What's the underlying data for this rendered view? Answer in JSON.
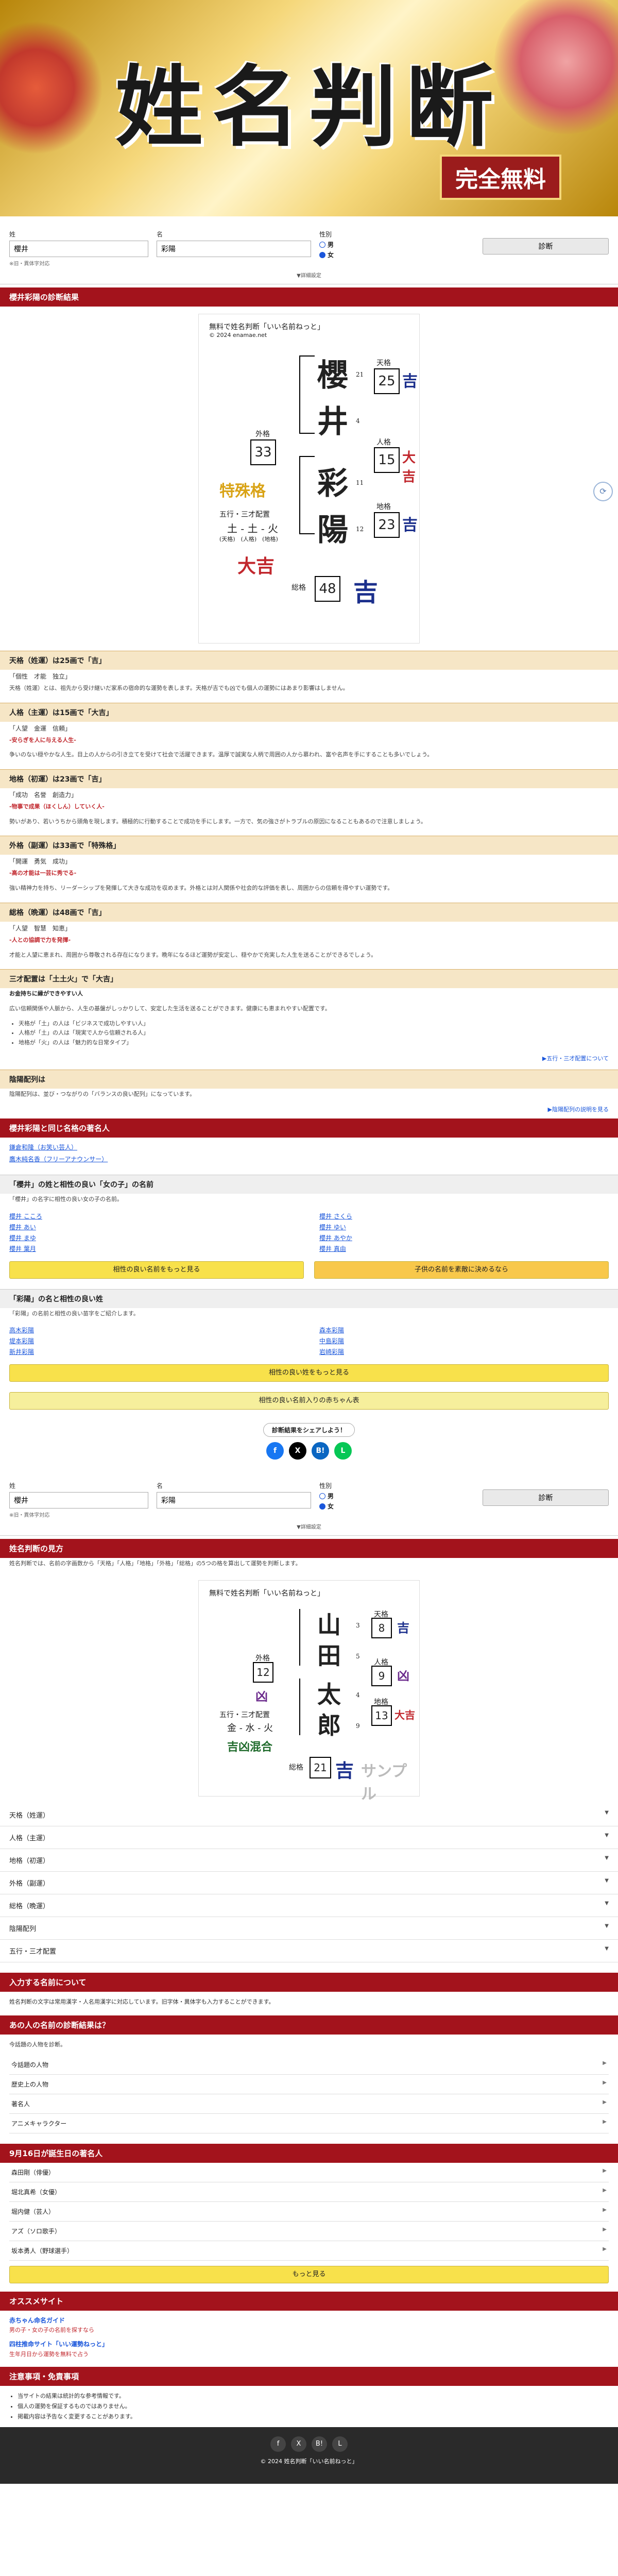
{
  "hero": {
    "title": "姓名判断",
    "badge": "完全無料"
  },
  "form": {
    "sei_label": "姓",
    "mei_label": "名",
    "sei_value": "櫻井",
    "mei_value": "彩陽",
    "gender_label": "性別",
    "male": "男",
    "female": "女",
    "note": "※旧・異体字対応",
    "button": "診断",
    "detail": "▼詳細設定"
  },
  "result": {
    "heading": "櫻井彩陽の診断結果",
    "chart_hdr": "無料で姓名判断「いい名前ねっと」",
    "chart_sub": "© 2024 enamae.net",
    "chars": [
      "櫻",
      "井",
      "彩",
      "陽"
    ],
    "strokes": [
      "21",
      "4",
      "11",
      "12"
    ],
    "grids": [
      {
        "label": "天格",
        "v": "25",
        "r": "吉"
      },
      {
        "label": "人格",
        "v": "15",
        "r": "大吉"
      },
      {
        "label": "地格",
        "v": "23",
        "r": "吉"
      },
      {
        "label": "外格",
        "v": "33",
        "r": ""
      },
      {
        "label": "総格",
        "v": "48",
        "r": "吉"
      }
    ],
    "special": "特殊格",
    "gogyo": "五行・三才配置",
    "gogyo_v": "土 - 土 - 火",
    "gogyo_l": "(天格)　(人格)　(地格)",
    "gogyo_r": "大吉"
  },
  "scores": [
    {
      "h": "天格（姓運）は25画で「吉」",
      "tags": "「個性　才能　独立」",
      "body": "天格（姓運）とは、祖先から受け継いだ家系の宿命的な運勢を表します。天格が吉でも凶でも個人の運勢にはあまり影響はしません。"
    },
    {
      "h": "人格（主運）は15画で「大吉」",
      "tags": "「人望　金運　信頼」",
      "lead": "-安らぎを人に与える人生-",
      "body": "争いのない穏やかな人生。目上の人からの引き立てを受けて社会で活躍できます。温厚で誠実な人柄で周囲の人から慕われ、富や名声を手にすることも多いでしょう。"
    },
    {
      "h": "地格（初運）は23画で「吉」",
      "tags": "「成功　名誉　創造力」",
      "lead": "-物事で成果（ほくしん）していく人-",
      "body": "勢いがあり、若いうちから頭角を現します。積極的に行動することで成功を手にします。一方で、気の強さがトラブルの原因になることもあるので注意しましょう。"
    },
    {
      "h": "外格（副運）は33画で「特殊格」",
      "tags": "「開運　勇気　成功」",
      "lead": "-高の才能は一芸に秀でる-",
      "body": "強い精神力を持ち、リーダーシップを発揮して大きな成功を収めます。外格とは対人関係や社会的な評価を表し、周囲からの信頼を得やすい運勢です。"
    },
    {
      "h": "総格（晩運）は48画で「吉」",
      "tags": "「人望　智慧　知恵」",
      "lead": "-人との協調で力を発揮-",
      "body": "才能と人望に恵まれ、周囲から尊敬される存在になります。晩年になるほど運勢が安定し、穏やかで充実した人生を送ることができるでしょう。"
    }
  ],
  "sansai": {
    "h": "三才配置は「土土火」で「大吉」",
    "lead": "お金持ちに縁ができやすい人",
    "body": "広い信頼関係や人脈から、人生の基盤がしっかりして、安定した生活を送ることができます。健康にも恵まれやすい配置です。",
    "items": [
      "天格が「土」の人は「ビジネスで成功しやすい人」",
      "人格が「土」の人は「現実で人から信頼される人」",
      "地格が「火」の人は「魅力的な日常タイプ」"
    ],
    "link": "▶五行・三才配置について"
  },
  "inyo": {
    "h": "陰陽配列は",
    "body": "陰陽配列は、並び・つながりの「バランスの良い配列」になっています。",
    "link": "▶陰陽配列の説明を見る"
  },
  "famous": {
    "h": "櫻井彩陽と同じ名格の著名人",
    "list": [
      "鎌倉和隆（お笑い芸人）",
      "鷹木純名香（フリーアナウンサー）"
    ]
  },
  "aisho": {
    "h": "「櫻井」の姓と相性の良い「女の子」の名前",
    "intro": "「櫻井」の名字に相性の良い女の子の名前。",
    "names": [
      "櫻井 こころ",
      "櫻井 さくら",
      "櫻井 あい",
      "櫻井 ゆい",
      "櫻井 まゆ",
      "櫻井 あやか",
      "櫻井 葉月",
      "櫻井 真由"
    ],
    "btn1": "相性の良い名前をもっと見る",
    "btn2": "子供の名前を素敵に決めるなら"
  },
  "ayaaki": {
    "h": "「彩陽」の名と相性の良い姓",
    "intro": "「彩陽」の名前と相性の良い苗字をご紹介します。",
    "names": [
      "高木彩陽",
      "森本彩陽",
      "堤本彩陽",
      "中島彩陽",
      "新井彩陽",
      "岩崎彩陽"
    ],
    "btn": "相性の良い姓をもっと見る",
    "btn2": "相性の良い名前入りの赤ちゃん表"
  },
  "share": {
    "title": "診断結果をシェアしよう！"
  },
  "form2": {
    "button": "診断"
  },
  "howto": {
    "h": "姓名判断の見方",
    "intro": "姓名判断では、名前の字画数から「天格」「人格」「地格」「外格」「総格」の5つの格を算出して運勢を判断します。",
    "chars": [
      "山",
      "田",
      "太",
      "郎"
    ],
    "strokes": [
      "3",
      "5",
      "4",
      "9"
    ],
    "grids": [
      {
        "label": "天格",
        "v": "8",
        "r": "吉"
      },
      {
        "label": "人格",
        "v": "9",
        "r": "凶"
      },
      {
        "label": "地格",
        "v": "13",
        "r": "大吉"
      },
      {
        "label": "外格",
        "v": "12",
        "r": "凶"
      },
      {
        "label": "総格",
        "v": "21",
        "r": "吉"
      }
    ],
    "gogyo": "五行・三才配置",
    "gogyo_v": "金 - 水 - 火",
    "gogyo_r": "吉凶混合",
    "sample": "サンプル"
  },
  "accordion": [
    "天格（姓運）",
    "人格（主運）",
    "地格（初運）",
    "外格（副運）",
    "総格（晩運）",
    "陰陽配列",
    "五行・三才配置"
  ],
  "about": {
    "h": "入力する名前について",
    "body": "姓名判断の文字は常用漢字・人名用漢字に対応しています。旧字体・異体字も入力することができます。"
  },
  "recommend": {
    "h": "あの人の名前の診断結果は？",
    "intro": "今話題の人物を診断。",
    "items": [
      "今話題の人物",
      "歴史上の人物",
      "著名人",
      "アニメキャラクター"
    ]
  },
  "birthday": {
    "h": "9月16日が誕生日の著名人",
    "items": [
      "森田剛（俳優）",
      "堀北真希（女優）",
      "堀内健（芸人）",
      "アズ（ソロ歌手）",
      "坂本勇人（野球選手）"
    ],
    "btn": "もっと見る"
  },
  "osusume": {
    "h": "オススメサイト",
    "items": [
      {
        "t": "赤ちゃん命名ガイド",
        "d": "男の子・女の子の名前を探すなら"
      },
      {
        "t": "四柱推命サイト「いい運勢ねっと」",
        "d": "生年月日から運勢を無料で占う"
      }
    ]
  },
  "notes": {
    "h": "注意事項・免責事項",
    "items": [
      "当サイトの結果は統計的な参考情報です。",
      "個人の運勢を保証するものではありません。",
      "掲載内容は予告なく変更することがあります。"
    ]
  },
  "footer": {
    "copy": "© 2024 姓名判断「いい名前ねっと」"
  }
}
